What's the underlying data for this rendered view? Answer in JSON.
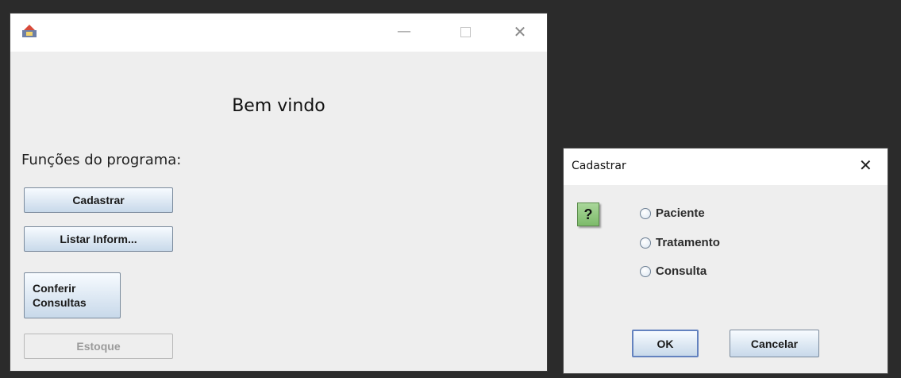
{
  "main_window": {
    "title_bar": {
      "app_icon": "java-app-icon",
      "controls": {
        "minimize": "—",
        "maximize_icon": "maximize-icon",
        "close": "✕"
      }
    },
    "welcome": "Bem vindo",
    "functions_label": "Funções do programa:",
    "buttons": {
      "cadastrar": "Cadastrar",
      "listar": "Listar Inform...",
      "conferir_line1": "Conferir",
      "conferir_line2": "Consultas",
      "estoque": "Estoque"
    }
  },
  "dialog": {
    "title": "Cadastrar",
    "close": "✕",
    "question_icon": "?",
    "options": [
      "Paciente",
      "Tratamento",
      "Consulta"
    ],
    "ok": "OK",
    "cancel": "Cancelar"
  },
  "colors": {
    "desktop": "#2b2b2b",
    "window_bg": "#eeeeee",
    "button_border": "#7a8a9c",
    "focus_border": "#6382bf",
    "question_icon": "#8cc97a"
  }
}
